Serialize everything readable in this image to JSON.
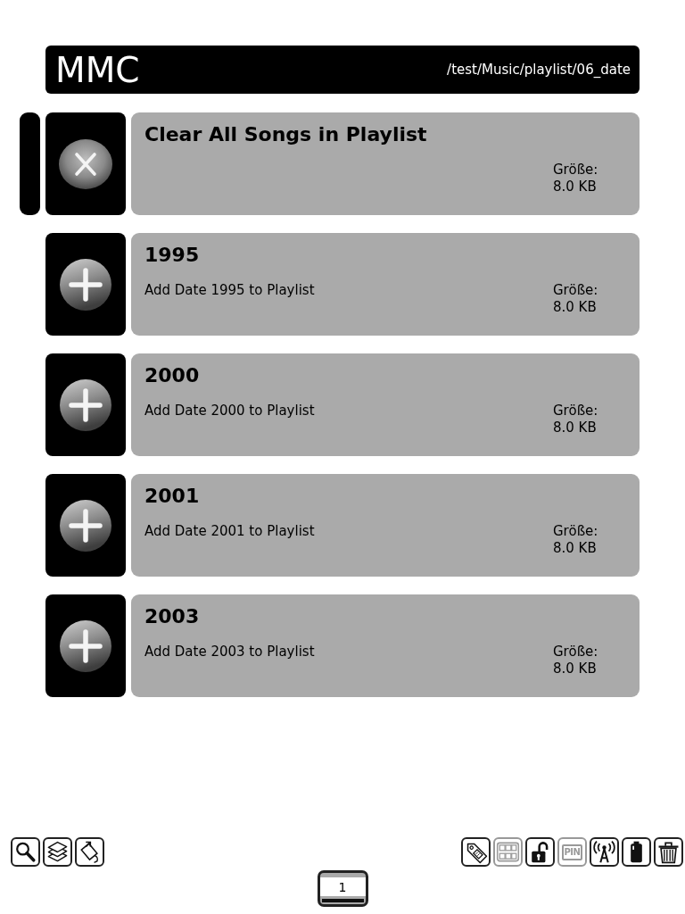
{
  "header": {
    "title": "MMC",
    "path": "/test/Music/playlist/06_date"
  },
  "rows": [
    {
      "kind": "clear",
      "selected": true,
      "title": "Clear All Songs in Playlist",
      "size_label": "Größe:",
      "size": "8.0 KB"
    },
    {
      "kind": "add",
      "selected": false,
      "title": "1995",
      "description": "Add Date 1995 to Playlist",
      "size_label": "Größe:",
      "size": "8.0 KB"
    },
    {
      "kind": "add",
      "selected": false,
      "title": "2000",
      "description": "Add Date 2000 to Playlist",
      "size_label": "Größe:",
      "size": "8.0 KB"
    },
    {
      "kind": "add",
      "selected": false,
      "title": "2001",
      "description": "Add Date 2001 to Playlist",
      "size_label": "Größe:",
      "size": "8.0 KB"
    },
    {
      "kind": "add",
      "selected": false,
      "title": "2003",
      "description": "Add Date 2003 to Playlist",
      "size_label": "Größe:",
      "size": "8.0 KB"
    }
  ],
  "toolbar_left": [
    {
      "kind": "search"
    },
    {
      "kind": "stack"
    },
    {
      "kind": "rotate"
    }
  ],
  "toolbar_right": [
    {
      "kind": "tag",
      "disabled": false
    },
    {
      "kind": "keyboard",
      "disabled": true
    },
    {
      "kind": "unlock",
      "disabled": false
    },
    {
      "kind": "pin",
      "label": "PIN",
      "disabled": true
    },
    {
      "kind": "antenna",
      "disabled": false
    },
    {
      "kind": "battery",
      "disabled": false
    },
    {
      "kind": "trash",
      "disabled": false
    }
  ],
  "page_indicator": {
    "number": "1"
  }
}
